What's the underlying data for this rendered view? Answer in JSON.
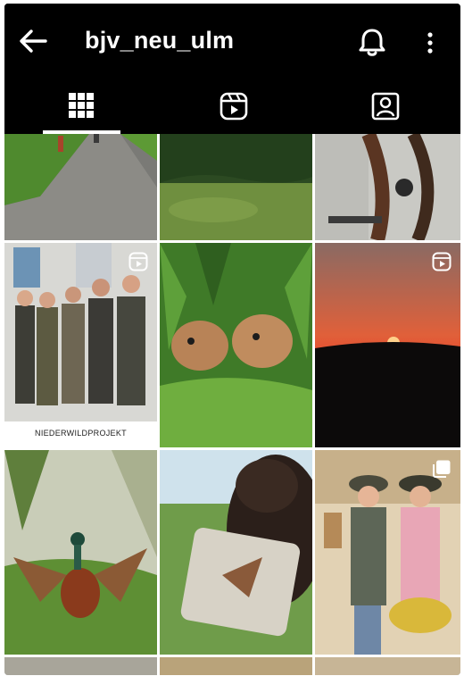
{
  "header": {
    "title": "bjv_neu_ulm"
  },
  "tabs": [
    {
      "name": "grid",
      "active": true
    },
    {
      "name": "reels",
      "active": false
    },
    {
      "name": "tagged",
      "active": false
    }
  ],
  "posts": [
    {
      "row": 1,
      "col": 1,
      "subject": "gravel-path",
      "type": "photo"
    },
    {
      "row": 1,
      "col": 2,
      "subject": "forest-meadow",
      "type": "photo"
    },
    {
      "row": 1,
      "col": 3,
      "subject": "carriage-wheel",
      "type": "photo"
    },
    {
      "row": 2,
      "col": 1,
      "subject": "group-of-men",
      "type": "reel",
      "caption": "NIEDERWILDPROJEKT"
    },
    {
      "row": 2,
      "col": 2,
      "subject": "fawns-in-grass",
      "type": "photo"
    },
    {
      "row": 2,
      "col": 3,
      "subject": "sunset",
      "type": "reel"
    },
    {
      "row": 3,
      "col": 1,
      "subject": "pheasant",
      "type": "photo"
    },
    {
      "row": 3,
      "col": 2,
      "subject": "dog-with-mug",
      "type": "photo"
    },
    {
      "row": 3,
      "col": 3,
      "subject": "two-women-hunters",
      "type": "carousel"
    }
  ]
}
